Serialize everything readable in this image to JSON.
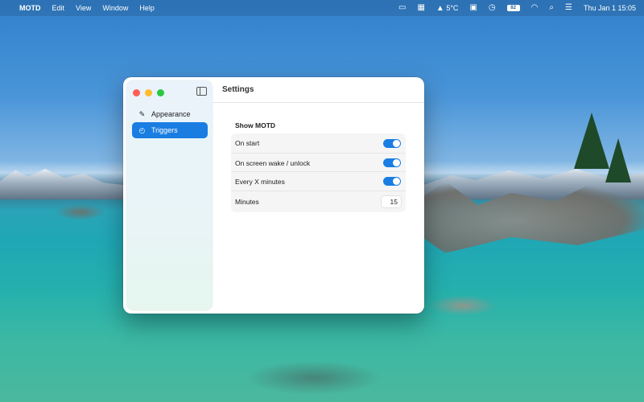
{
  "menubar": {
    "apple_icon": "apple-logo-icon",
    "app_name": "MOTD",
    "menus": [
      "Edit",
      "View",
      "Window",
      "Help"
    ],
    "weather": "5°C",
    "battery": "82",
    "clock": "Thu Jan 1  15:05"
  },
  "window": {
    "title": "Settings",
    "sidebar": {
      "items": [
        {
          "label": "Appearance",
          "icon": "paintbrush-icon",
          "active": false
        },
        {
          "label": "Triggers",
          "icon": "clock-icon",
          "active": true
        }
      ]
    },
    "section": {
      "title": "Show MOTD",
      "rows": [
        {
          "label": "On start",
          "enabled": true
        },
        {
          "label": "On screen wake / unlock",
          "enabled": true
        },
        {
          "label": "Every X minutes",
          "enabled": true
        }
      ],
      "minutes_label": "Minutes",
      "minutes_value": "15"
    }
  },
  "colors": {
    "accent": "#1a7de2",
    "close": "#ff5f57",
    "minimize": "#febc2e",
    "maximize": "#28c840"
  }
}
